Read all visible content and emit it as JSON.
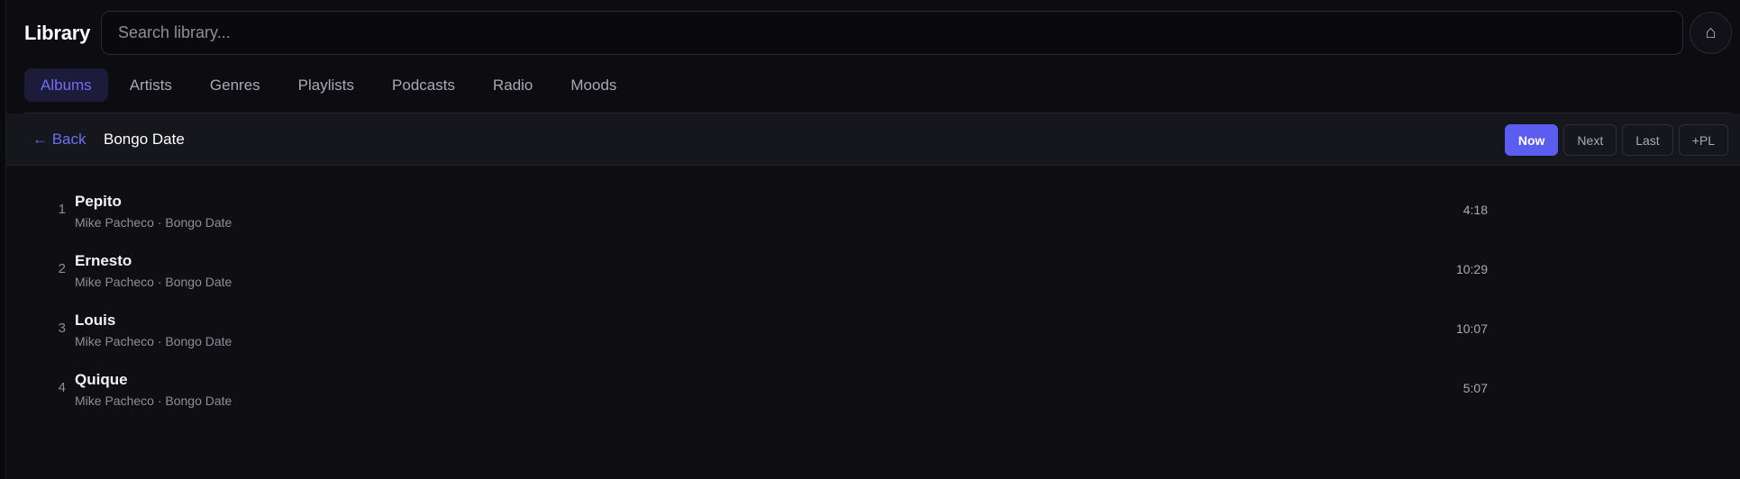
{
  "header": {
    "title": "Library",
    "search_placeholder": "Search library...",
    "search_value": "",
    "home_icon": "home-icon",
    "home_glyph": "⌂"
  },
  "tabs": [
    {
      "label": "Albums",
      "active": true
    },
    {
      "label": "Artists",
      "active": false
    },
    {
      "label": "Genres",
      "active": false
    },
    {
      "label": "Playlists",
      "active": false
    },
    {
      "label": "Podcasts",
      "active": false
    },
    {
      "label": "Radio",
      "active": false
    },
    {
      "label": "Moods",
      "active": false
    }
  ],
  "album": {
    "back_label": "← Back",
    "title": "Bongo Date",
    "actions": {
      "now": "Now",
      "next": "Next",
      "last": "Last",
      "add_playlist": "+PL"
    }
  },
  "tracks": [
    {
      "num": "1",
      "name": "Pepito",
      "meta": "Mike Pacheco · Bongo Date",
      "duration": "4:18"
    },
    {
      "num": "2",
      "name": "Ernesto",
      "meta": "Mike Pacheco · Bongo Date",
      "duration": "10:29"
    },
    {
      "num": "3",
      "name": "Louis",
      "meta": "Mike Pacheco · Bongo Date",
      "duration": "10:07"
    },
    {
      "num": "4",
      "name": "Quique",
      "meta": "Mike Pacheco · Bongo Date",
      "duration": "5:07"
    }
  ],
  "colors": {
    "accent": "#5b5cf0",
    "accent_text": "#6e6ef5",
    "background": "#0e0e13",
    "panel": "#16161d"
  }
}
